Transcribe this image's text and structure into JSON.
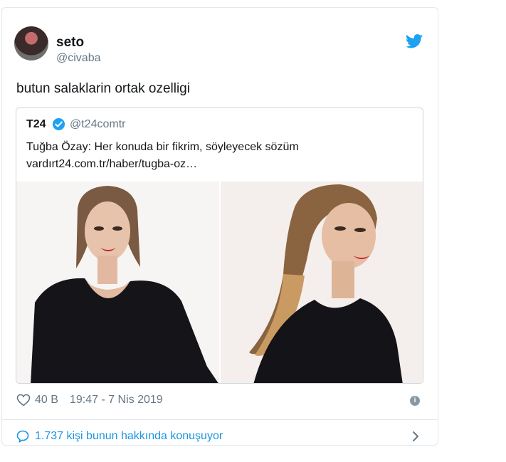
{
  "author": {
    "name": "seto",
    "handle": "@civaba"
  },
  "tweet": {
    "text": "butun salaklarin ortak ozelligi"
  },
  "quoted": {
    "name": "T24",
    "handle": "@t24comtr",
    "text_line1": "Tuğba Özay: Her konuda bir fikrim, söyleyecek sözüm",
    "text_line2": "vardırt24.com.tr/haber/tugba-oz…"
  },
  "stats": {
    "likes": "40 B",
    "timestamp": "19:47 - 7 Nis 2019"
  },
  "conversation": {
    "label": "1.737 kişi bunun hakkında konuşuyor"
  },
  "icons": [
    "twitter-bird-icon",
    "verified-badge-icon",
    "heart-icon",
    "info-icon",
    "speech-bubble-icon",
    "chevron-right-icon"
  ],
  "colors": {
    "brand": "#1da1f2",
    "link": "#1b95e0",
    "muted": "#657786",
    "border": "#e1e8ed"
  }
}
